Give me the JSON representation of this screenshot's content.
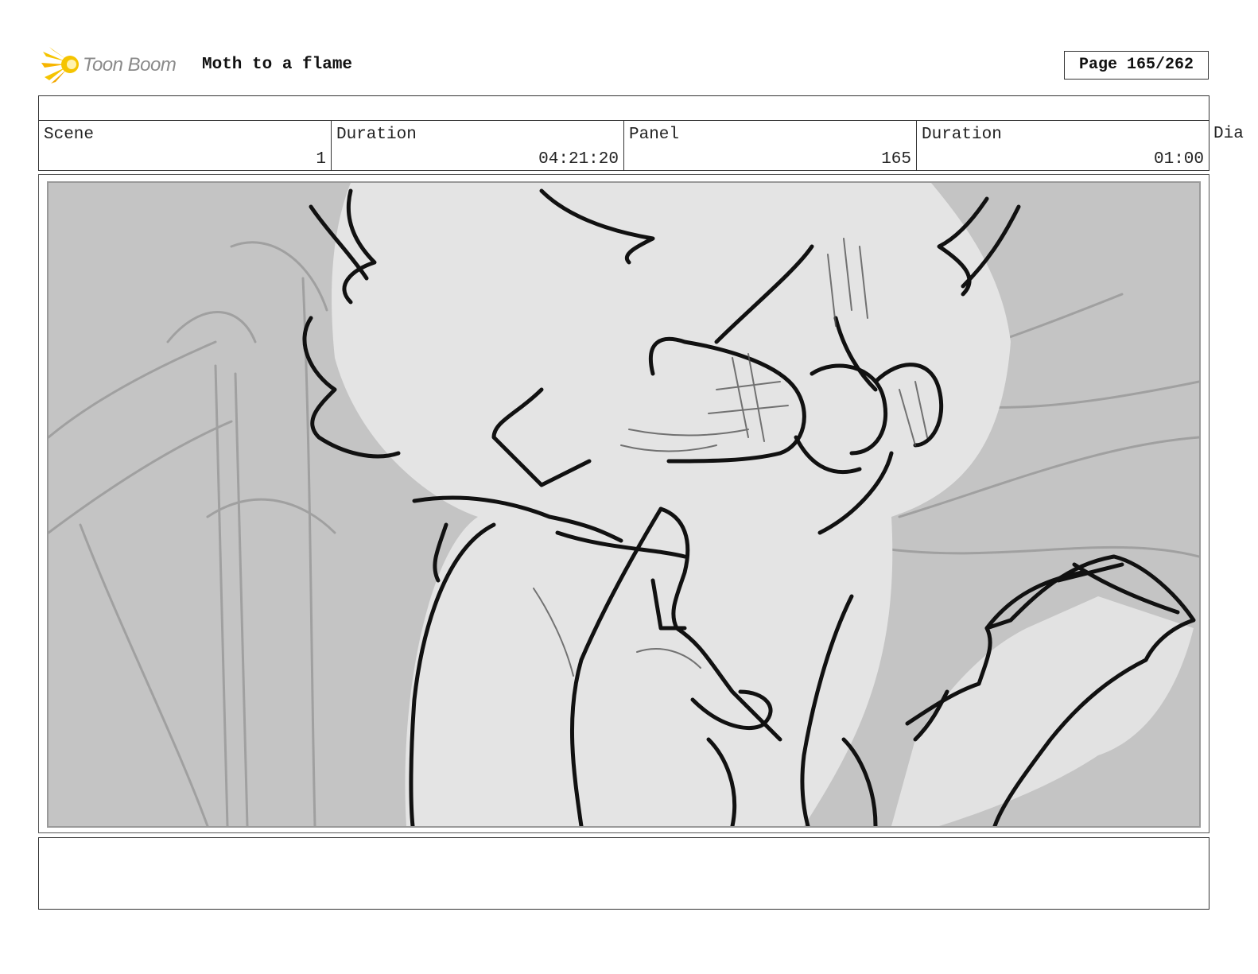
{
  "header": {
    "logo_text": "Toon Boom",
    "project_title": "Moth to a flame",
    "page_label": "Page 165/262"
  },
  "info": {
    "scene_label": "Scene",
    "scene_value": "1",
    "scene_duration_label": "Duration",
    "scene_duration_value": "04:21:20",
    "panel_label": "Panel",
    "panel_value": "165",
    "panel_duration_label": "Duration",
    "panel_duration_value": "01:00",
    "dialogue_label": "Dia"
  },
  "colors": {
    "logo_accent": "#f5c400",
    "frame_background": "#c4c4c4",
    "figure_fill": "#e4e4e4",
    "sketch_line": "#111111"
  },
  "icons": {
    "logo": "toon-boom-flame-icon"
  }
}
